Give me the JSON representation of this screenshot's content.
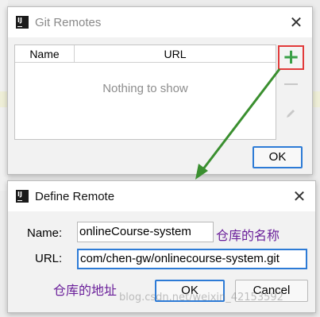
{
  "git_remotes": {
    "title": "Git Remotes",
    "close_glyph": "✕",
    "columns": [
      "Name",
      "URL"
    ],
    "empty_message": "Nothing to show",
    "toolbar": {
      "add_glyph": "+",
      "add_icon": "plus-icon",
      "remove_icon": "minus-icon",
      "edit_icon": "pencil-icon"
    },
    "ok_label": "OK"
  },
  "define_remote": {
    "title": "Define Remote",
    "close_glyph": "✕",
    "name_label": "Name:",
    "name_value": "onlineCourse-system",
    "url_label": "URL:",
    "url_value": "com/chen-gw/onlinecourse-system.git",
    "ok_label": "OK",
    "cancel_label": "Cancel"
  },
  "annotations": {
    "name_note": "仓库的名称",
    "url_note": "仓库的地址",
    "arrow_color": "#3a8f2f"
  },
  "colors": {
    "highlight_red": "#e23b3b",
    "focus_blue": "#2d7bd6",
    "add_green": "#3aa047",
    "note_purple": "#6a1f9a"
  }
}
